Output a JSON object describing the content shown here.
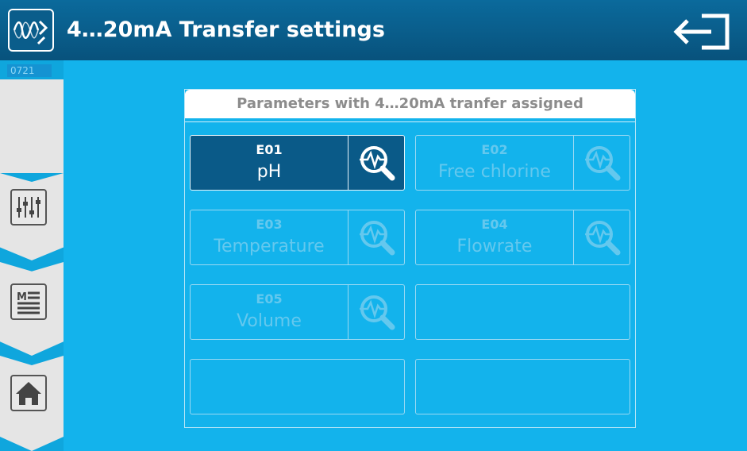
{
  "header": {
    "title": "4…20mA Transfer settings",
    "app_icon": "waveform-transfer-icon",
    "exit_icon": "exit-door-icon"
  },
  "sidebar": {
    "code": "0721",
    "buttons": [
      {
        "icon": "sliders-icon"
      },
      {
        "icon": "menu-list-icon"
      },
      {
        "icon": "home-icon"
      }
    ]
  },
  "panel": {
    "title": "Parameters with 4…20mA tranfer assigned",
    "params": [
      {
        "code": "E01",
        "name": "pH",
        "active": true
      },
      {
        "code": "E02",
        "name": "Free chlorine",
        "active": false
      },
      {
        "code": "E03",
        "name": "Temperature",
        "active": false
      },
      {
        "code": "E04",
        "name": "Flowrate",
        "active": false
      },
      {
        "code": "E05",
        "name": "Volume",
        "active": false
      }
    ],
    "view_icon": "magnifier-pulse-icon"
  },
  "colors": {
    "background": "#13b3ec",
    "header": "#08527c",
    "active_tile": "#0a5a88",
    "inactive_text": "#64c8ee",
    "sidebar_panel": "#e5e5e5"
  }
}
